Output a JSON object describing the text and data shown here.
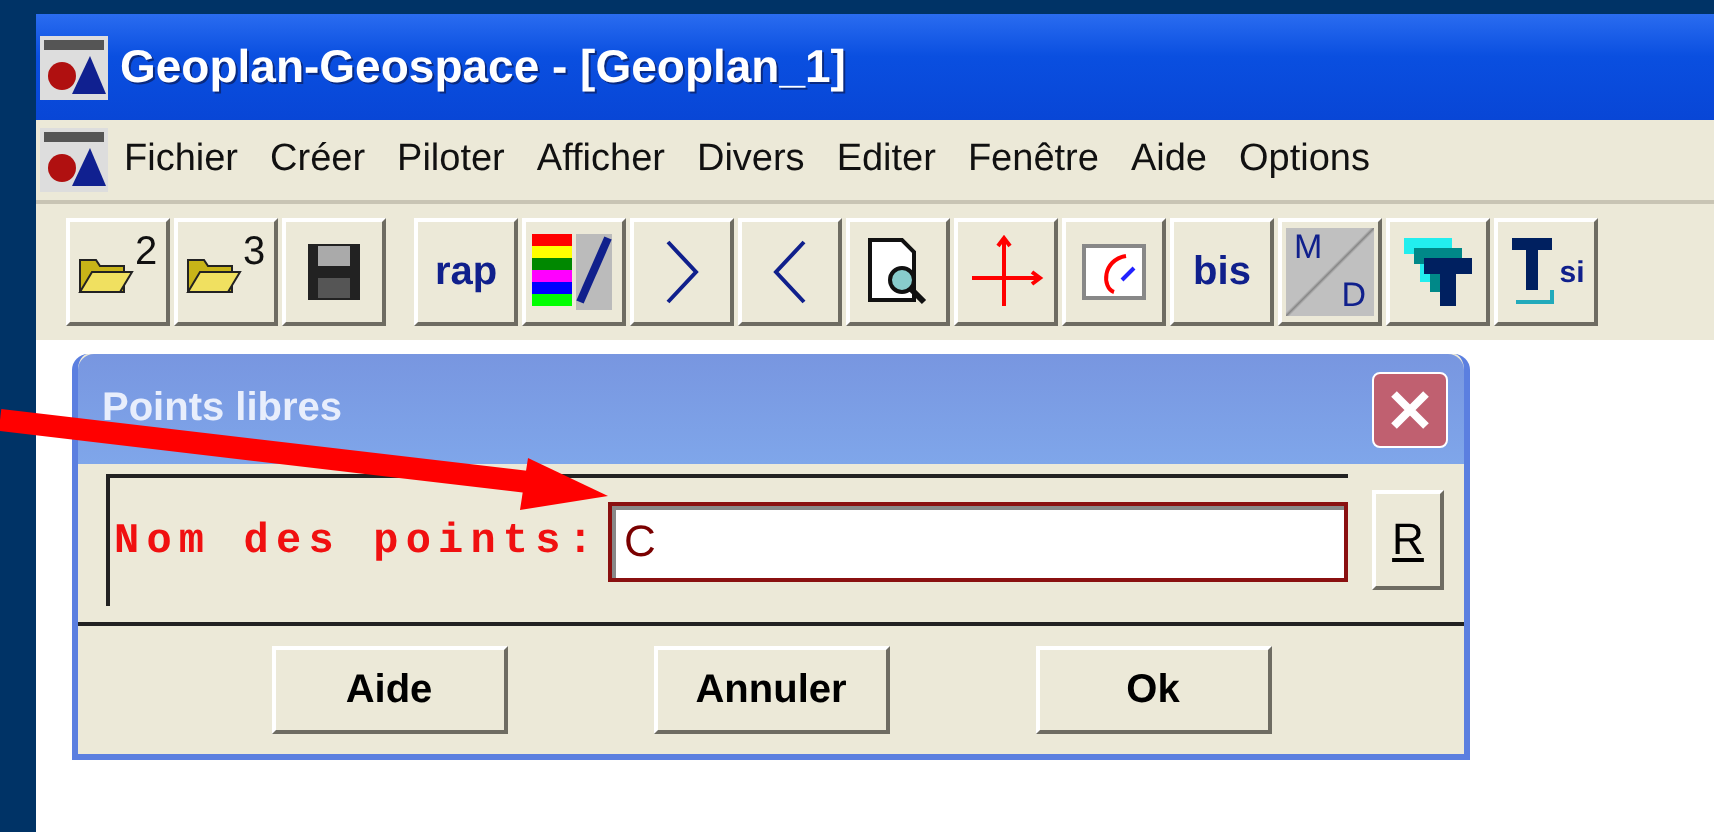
{
  "window": {
    "title": "Geoplan-Geospace - [Geoplan_1]"
  },
  "menu": [
    "Fichier",
    "Créer",
    "Piloter",
    "Afficher",
    "Divers",
    "Editer",
    "Fenêtre",
    "Aide",
    "Options"
  ],
  "toolbar": [
    {
      "kind": "folder",
      "label": "2"
    },
    {
      "kind": "folder",
      "label": "3"
    },
    {
      "kind": "save"
    },
    {
      "kind": "text",
      "label": "rap",
      "gap": true
    },
    {
      "kind": "palette"
    },
    {
      "kind": "chevron-right"
    },
    {
      "kind": "chevron-left"
    },
    {
      "kind": "preview"
    },
    {
      "kind": "axes"
    },
    {
      "kind": "arc"
    },
    {
      "kind": "text",
      "label": "bis"
    },
    {
      "kind": "fraction",
      "top": "M",
      "bottom": "D"
    },
    {
      "kind": "stacked-t"
    },
    {
      "kind": "tsi",
      "label": "si"
    }
  ],
  "dialog": {
    "title": "Points libres",
    "field_label": "Nom des points:",
    "field_value": "C",
    "side_button": "R",
    "buttons": [
      "Aide",
      "Annuler",
      "Ok"
    ]
  }
}
